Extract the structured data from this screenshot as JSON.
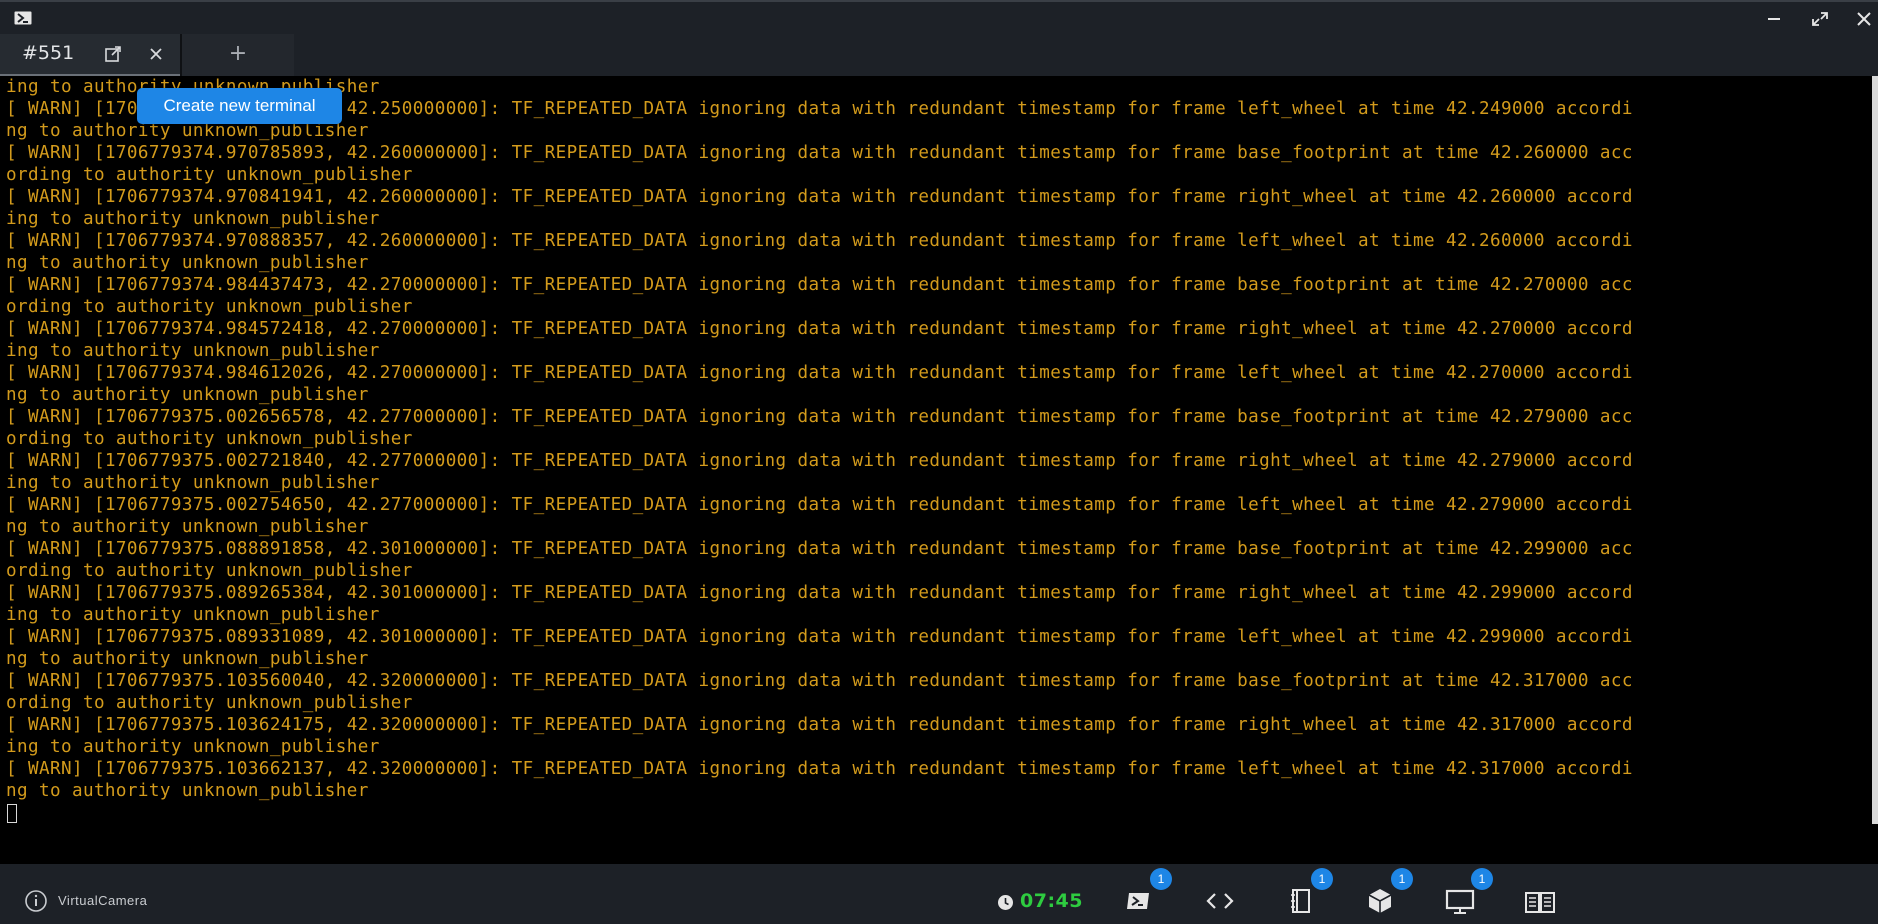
{
  "window": {
    "app_icon": "terminal-app-icon",
    "controls": [
      "minimize-icon",
      "maximize-icon",
      "close-icon"
    ]
  },
  "tabs": {
    "active_label": "#551",
    "new_tab_label": "+"
  },
  "tooltip": "Create new terminal",
  "terminal": {
    "lines": [
      "ing to authority unknown_publisher",
      "[ WARN] [1706779374.957011716, 42.250000000]: TF_REPEATED_DATA ignoring data with redundant timestamp for frame left_wheel at time 42.249000 accordi",
      "ng to authority unknown_publisher",
      "[ WARN] [1706779374.970785893, 42.260000000]: TF_REPEATED_DATA ignoring data with redundant timestamp for frame base_footprint at time 42.260000 acc",
      "ording to authority unknown_publisher",
      "[ WARN] [1706779374.970841941, 42.260000000]: TF_REPEATED_DATA ignoring data with redundant timestamp for frame right_wheel at time 42.260000 accord",
      "ing to authority unknown_publisher",
      "[ WARN] [1706779374.970888357, 42.260000000]: TF_REPEATED_DATA ignoring data with redundant timestamp for frame left_wheel at time 42.260000 accordi",
      "ng to authority unknown_publisher",
      "[ WARN] [1706779374.984437473, 42.270000000]: TF_REPEATED_DATA ignoring data with redundant timestamp for frame base_footprint at time 42.270000 acc",
      "ording to authority unknown_publisher",
      "[ WARN] [1706779374.984572418, 42.270000000]: TF_REPEATED_DATA ignoring data with redundant timestamp for frame right_wheel at time 42.270000 accord",
      "ing to authority unknown_publisher",
      "[ WARN] [1706779374.984612026, 42.270000000]: TF_REPEATED_DATA ignoring data with redundant timestamp for frame left_wheel at time 42.270000 accordi",
      "ng to authority unknown_publisher",
      "[ WARN] [1706779375.002656578, 42.277000000]: TF_REPEATED_DATA ignoring data with redundant timestamp for frame base_footprint at time 42.279000 acc",
      "ording to authority unknown_publisher",
      "[ WARN] [1706779375.002721840, 42.277000000]: TF_REPEATED_DATA ignoring data with redundant timestamp for frame right_wheel at time 42.279000 accord",
      "ing to authority unknown_publisher",
      "[ WARN] [1706779375.002754650, 42.277000000]: TF_REPEATED_DATA ignoring data with redundant timestamp for frame left_wheel at time 42.279000 accordi",
      "ng to authority unknown_publisher",
      "[ WARN] [1706779375.088891858, 42.301000000]: TF_REPEATED_DATA ignoring data with redundant timestamp for frame base_footprint at time 42.299000 acc",
      "ording to authority unknown_publisher",
      "[ WARN] [1706779375.089265384, 42.301000000]: TF_REPEATED_DATA ignoring data with redundant timestamp for frame right_wheel at time 42.299000 accord",
      "ing to authority unknown_publisher",
      "[ WARN] [1706779375.089331089, 42.301000000]: TF_REPEATED_DATA ignoring data with redundant timestamp for frame left_wheel at time 42.299000 accordi",
      "ng to authority unknown_publisher",
      "[ WARN] [1706779375.103560040, 42.320000000]: TF_REPEATED_DATA ignoring data with redundant timestamp for frame base_footprint at time 42.317000 acc",
      "ording to authority unknown_publisher",
      "[ WARN] [1706779375.103624175, 42.320000000]: TF_REPEATED_DATA ignoring data with redundant timestamp for frame right_wheel at time 42.317000 accord",
      "ing to authority unknown_publisher",
      "[ WARN] [1706779375.103662137, 42.320000000]: TF_REPEATED_DATA ignoring data with redundant timestamp for frame left_wheel at time 42.317000 accordi",
      "ng to authority unknown_publisher"
    ]
  },
  "taskbar": {
    "camera_label": "VirtualCamera",
    "clock": "07:45",
    "badges": {
      "terminal": "1",
      "notes": "1",
      "packages": "1",
      "display": "1"
    }
  },
  "colors": {
    "warn_text": "#d39b1c",
    "accent": "#1e86e6",
    "clock": "#2ecc40"
  }
}
